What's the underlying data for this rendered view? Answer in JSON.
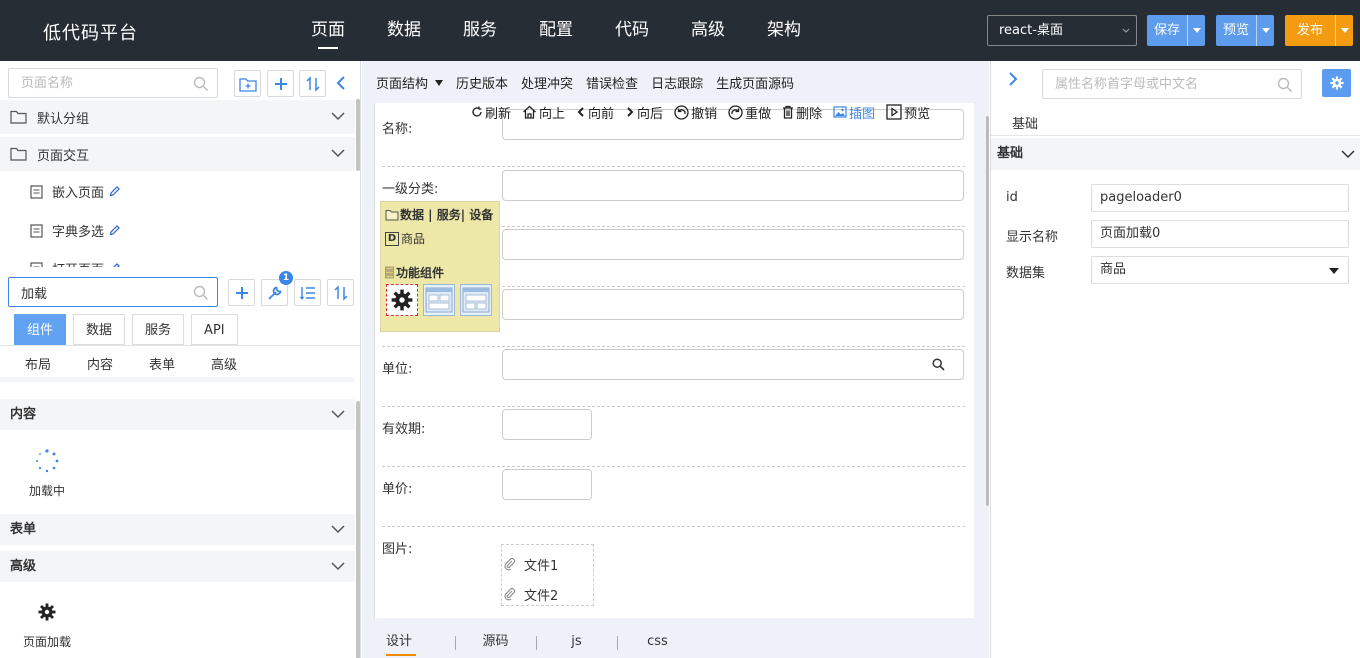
{
  "app": {
    "title": "低代码平台"
  },
  "nav": {
    "items": [
      "页面",
      "数据",
      "服务",
      "配置",
      "代码",
      "高级",
      "架构"
    ],
    "active_index": 0
  },
  "env_select": {
    "value": "react-桌面"
  },
  "actions": {
    "save": {
      "label": "保存",
      "color": "#5d9cec"
    },
    "preview": {
      "label": "预览",
      "color": "#5d9cec"
    },
    "publish": {
      "label": "发布",
      "color": "#f39c12"
    }
  },
  "page_tree": {
    "search_placeholder": "页面名称",
    "groups": [
      {
        "label": "默认分组"
      },
      {
        "label": "页面交互"
      }
    ],
    "leaves": [
      "嵌入页面",
      "字典多选",
      "打开页面"
    ]
  },
  "component_panel": {
    "search_value": "加载",
    "badge": "1",
    "tabs": [
      "组件",
      "数据",
      "服务",
      "API"
    ],
    "active_tab": 0,
    "subtabs": [
      "布局",
      "内容",
      "表单",
      "高级"
    ],
    "sections": {
      "content": {
        "label": "内容",
        "item": "加载中"
      },
      "form": {
        "label": "表单"
      },
      "advanced": {
        "label": "高级",
        "item": "页面加载"
      }
    }
  },
  "editor": {
    "menu": [
      "页面结构",
      "历史版本",
      "处理冲突",
      "错误检查",
      "日志跟踪",
      "生成页面源码"
    ],
    "toolbar": [
      "刷新",
      "向上",
      "向前",
      "向后",
      "撤销",
      "重做",
      "删除",
      "插图",
      "预览"
    ],
    "form": {
      "name_label": "名称:",
      "category_label": "一级分类:",
      "unit_label": "单位:",
      "validity_label": "有效期:",
      "price_label": "单价:",
      "image_label": "图片:",
      "files": [
        "文件1",
        "文件2"
      ]
    },
    "palette": {
      "header": "数据 | 服务| 设备",
      "entity": "商品",
      "group": "功能组件"
    },
    "bottom_tabs": [
      "设计",
      "源码",
      "js",
      "css"
    ],
    "active_bottom_tab": 0
  },
  "properties": {
    "search_placeholder": "属性名称首字母或中文名",
    "tab": "基础",
    "section": "基础",
    "rows": [
      {
        "label": "id",
        "value": "pageloader0"
      },
      {
        "label": "显示名称",
        "value": "页面加载0"
      },
      {
        "label": "数据集",
        "value": "商品"
      }
    ]
  }
}
